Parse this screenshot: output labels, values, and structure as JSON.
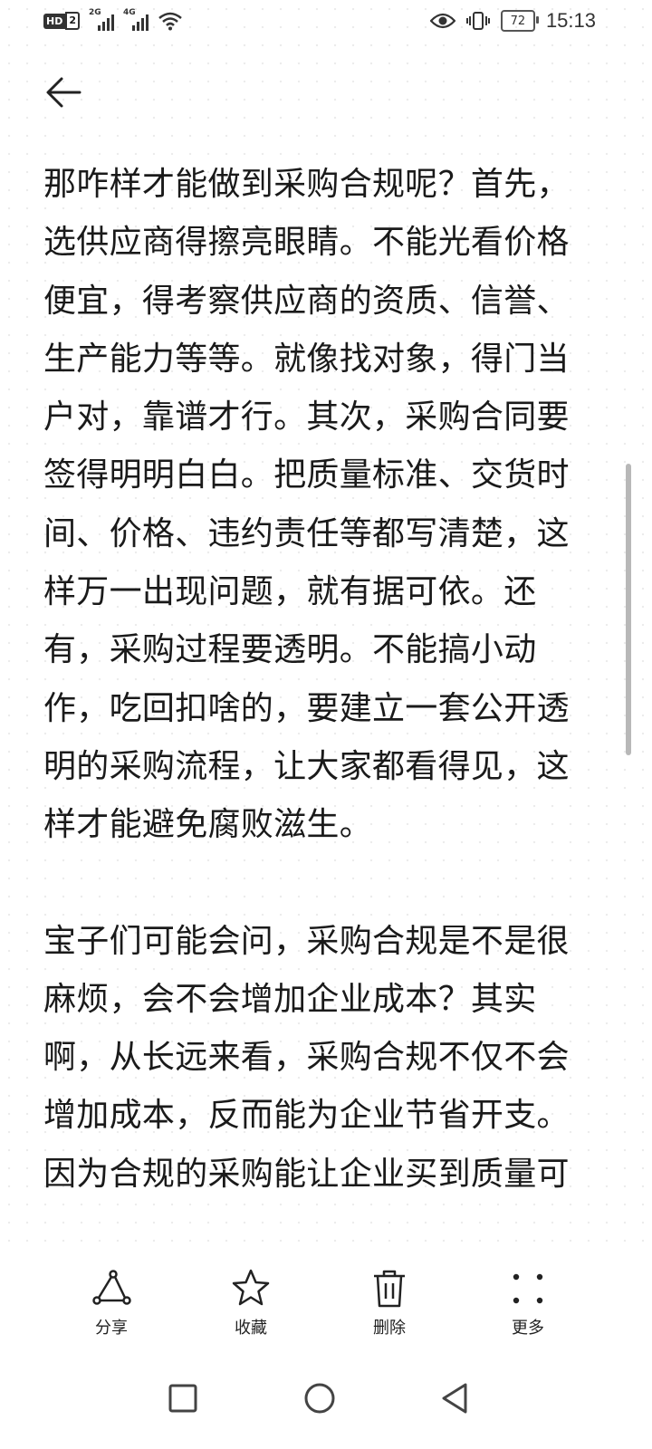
{
  "status_bar": {
    "hd_label": "HD",
    "hd_number": "2",
    "signal_1": "2G",
    "signal_2": "4G",
    "battery_level": "72",
    "time": "15:13",
    "icons": [
      "eye-icon",
      "vibrate-icon",
      "wifi-icon"
    ]
  },
  "article": {
    "paragraphs": [
      "那咋样才能做到采购合规呢？首先，选供应商得擦亮眼睛。不能光看价格便宜，得考察供应商的资质、信誉、生产能力等等。就像找对象，得门当户对，靠谱才行。其次，采购合同要签得明明白白。把质量标准、交货时间、价格、违约责任等都写清楚，这样万一出现问题，就有据可依。还有，采购过程要透明。不能搞小动作，吃回扣啥的，要建立一套公开透明的采购流程，让大家都看得见，这样才能避免腐败滋生。",
      "宝子们可能会问，采购合规是不是很麻烦，会不会增加企业成本？其实啊，从长远来看，采购合规不仅不会增加成本，反而能为企业节省开支。因为合规的采购能让企业买到质量可"
    ]
  },
  "toolbar": {
    "share": "分享",
    "favorite": "收藏",
    "delete": "删除",
    "more": "更多"
  },
  "navbar": {
    "icons": [
      "recents-icon",
      "home-icon",
      "back-nav-icon"
    ]
  }
}
